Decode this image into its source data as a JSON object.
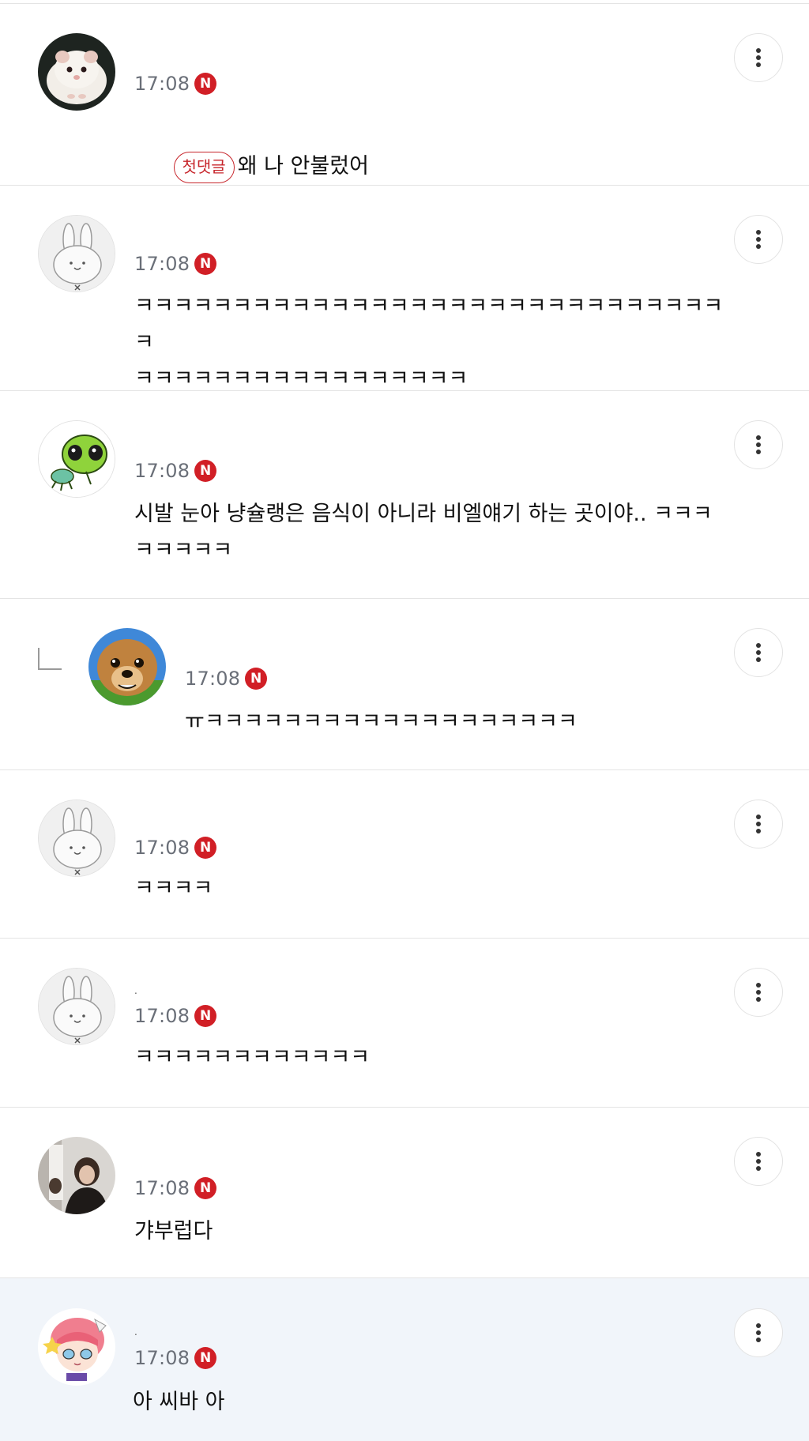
{
  "comments": [
    {
      "time": "17:08",
      "badge": "N",
      "first_tag": "첫댓글",
      "text": "왜 나 안불렀어",
      "avatar": "hamster-photo"
    },
    {
      "time": "17:08",
      "badge": "N",
      "text": "ㅋㅋㅋㅋㅋㅋㅋㅋㅋㅋㅋㅋㅋㅋㅋㅋㅋㅋㅋㅋㅋㅋㅋㅋㅋㅋㅋㅋㅋㅋㅋ\nㅋㅋㅋㅋㅋㅋㅋㅋㅋㅋㅋㅋㅋㅋㅋㅋㅋ",
      "avatar": "default-rabbit"
    },
    {
      "time": "17:08",
      "badge": "N",
      "text": "시발 눈아 냥슐랭은 음식이 아니라 비엘얘기 하는 곳이야.. ㅋㅋㅋ\nㅋㅋㅋㅋㅋ",
      "avatar": "green-alien-sticker"
    },
    {
      "time": "17:08",
      "badge": "N",
      "text": "ㅠㅋㅋㅋㅋㅋㅋㅋㅋㅋㅋㅋㅋㅋㅋㅋㅋㅋㅋㅋ",
      "avatar": "dog-photo",
      "is_reply": true
    },
    {
      "time": "17:08",
      "badge": "N",
      "text": "ㅋㅋㅋㅋ",
      "avatar": "default-rabbit"
    },
    {
      "time": "17:08",
      "badge": "N",
      "text": "ㅋㅋㅋㅋㅋㅋㅋㅋㅋㅋㅋㅋ",
      "avatar": "default-rabbit",
      "nickname": "."
    },
    {
      "time": "17:08",
      "badge": "N",
      "text": "갸부럽다",
      "avatar": "person-photo"
    },
    {
      "time": "17:08",
      "badge": "N",
      "text": "아 씨바 아",
      "avatar": "anime-girl-avatar",
      "nickname": ".",
      "highlighted": true
    }
  ],
  "icons": {
    "more": "more-vertical-icon",
    "new_badge": "new-badge-icon",
    "reply": "reply-arrow-icon"
  },
  "colors": {
    "badge_red": "#d11f26",
    "time_gray": "#6a6f78",
    "first_tag_red": "#c7262c",
    "highlight_bg": "#f1f5fa"
  }
}
